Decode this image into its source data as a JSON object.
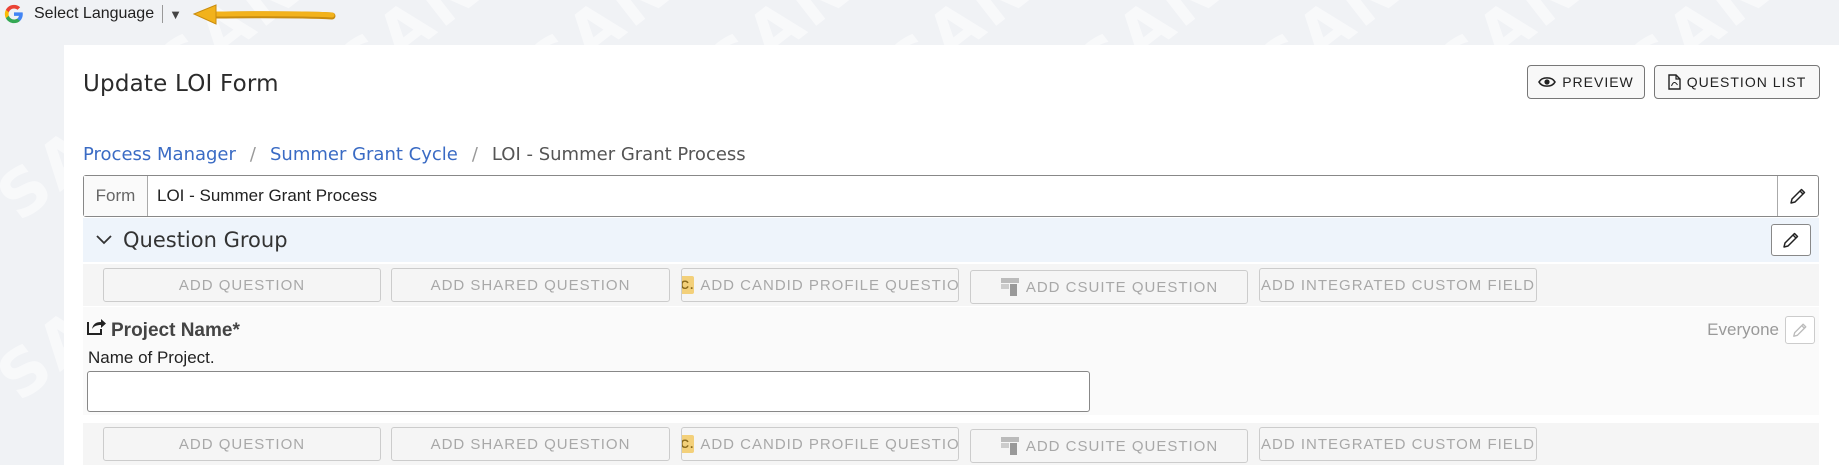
{
  "language_selector": {
    "label": "Select Language"
  },
  "watermark": "SAN",
  "page": {
    "title": "Update LOI Form"
  },
  "header_buttons": {
    "preview": "PREVIEW",
    "question_list": "QUESTION LIST"
  },
  "breadcrumb": [
    "Process Manager",
    "Summer Grant Cycle",
    "LOI - Summer Grant Process"
  ],
  "form": {
    "label": "Form",
    "value": "LOI - Summer Grant Process"
  },
  "question_group": {
    "title": "Question Group"
  },
  "add_buttons": {
    "add_question": "ADD QUESTION",
    "add_shared_question": "ADD SHARED QUESTION",
    "add_candid_profile_question": "ADD CANDID PROFILE QUESTIO",
    "candid_badge": "C.",
    "add_csuite_question": "ADD CSUITE QUESTION",
    "add_integrated_custom_field": "ADD INTEGRATED CUSTOM FIELD"
  },
  "question": {
    "name": "Project Name*",
    "help_text": "Name of Project.",
    "audience": "Everyone",
    "value": ""
  },
  "icons": {
    "language": "google-logo-icon",
    "dropdown": "caret-down-icon",
    "annotation": "yellow-arrow-icon",
    "preview": "eye-icon",
    "question_list": "pdf-file-icon",
    "edit": "pencil-icon",
    "collapse": "chevron-down-icon",
    "share": "share-icon",
    "csuite": "csuite-icon"
  },
  "colors": {
    "link": "#3a6bc4",
    "group_bg": "#eef4fb",
    "annotation_arrow": "#f2b21c",
    "disabled_text": "#a8a8a8"
  }
}
